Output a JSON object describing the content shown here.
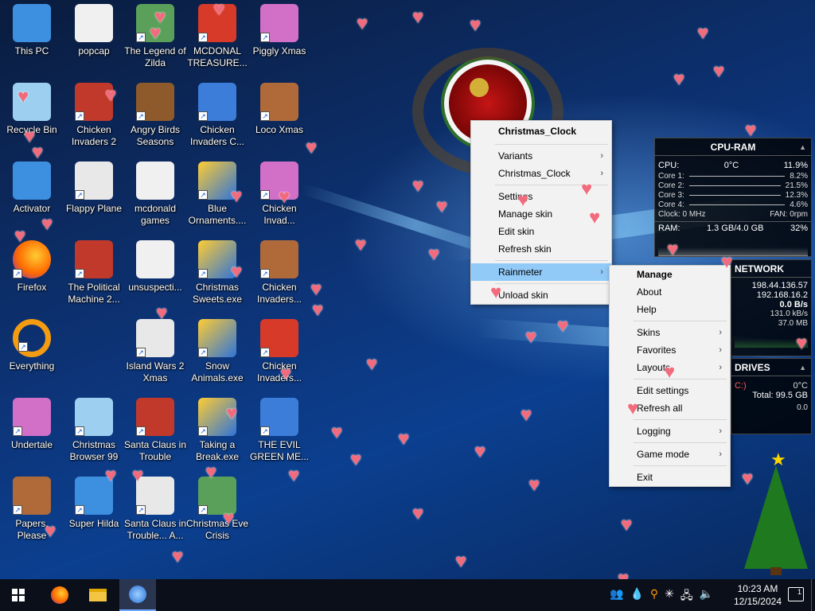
{
  "desktop": {
    "icons": [
      {
        "label": "This PC",
        "icon": "this-pc-icon"
      },
      {
        "label": "popcap",
        "icon": "folder-icon"
      },
      {
        "label": "The Legend of Zilda",
        "icon": "game-icon"
      },
      {
        "label": "MCDONAL TREASURE...",
        "icon": "game-icon"
      },
      {
        "label": "Piggly Xmas",
        "icon": "game-icon"
      },
      {
        "label": "Recycle Bin",
        "icon": "recycle-bin-icon"
      },
      {
        "label": "Chicken Invaders 2",
        "icon": "game-icon"
      },
      {
        "label": "Angry Birds Seasons",
        "icon": "game-icon"
      },
      {
        "label": "Chicken Invaders C...",
        "icon": "game-icon"
      },
      {
        "label": "Loco Xmas",
        "icon": "game-icon"
      },
      {
        "label": "Activator",
        "icon": "file-icon"
      },
      {
        "label": "Flappy Plane",
        "icon": "game-icon"
      },
      {
        "label": "mcdonald games",
        "icon": "folder-icon"
      },
      {
        "label": "Blue Ornaments....",
        "icon": "exe-icon"
      },
      {
        "label": "Chicken Invad...",
        "icon": "game-icon"
      },
      {
        "label": "Firefox",
        "icon": "firefox-icon"
      },
      {
        "label": "The Political Machine 2...",
        "icon": "game-icon"
      },
      {
        "label": "unsuspecti...",
        "icon": "folder-icon"
      },
      {
        "label": "Christmas Sweets.exe",
        "icon": "exe-icon"
      },
      {
        "label": "Chicken Invaders...",
        "icon": "game-icon"
      },
      {
        "label": "Everything",
        "icon": "search-app-icon"
      },
      {
        "label": "Island Wars 2 Xmas",
        "icon": "game-icon"
      },
      {
        "label": "Snow Animals.exe",
        "icon": "exe-icon"
      },
      {
        "label": "Chicken Invaders...",
        "icon": "game-icon"
      },
      {
        "label": "Undertale",
        "icon": "game-icon"
      },
      {
        "label": "Christmas Browser 99",
        "icon": "game-icon"
      },
      {
        "label": "Santa Claus in Trouble",
        "icon": "game-icon"
      },
      {
        "label": "Taking a Break.exe",
        "icon": "exe-icon"
      },
      {
        "label": "THE EVIL GREEN ME...",
        "icon": "game-icon"
      },
      {
        "label": "Papers, Please",
        "icon": "game-icon"
      },
      {
        "label": "Super Hilda",
        "icon": "game-icon"
      },
      {
        "label": "Santa Claus in Trouble... A...",
        "icon": "game-icon"
      },
      {
        "label": "Christmas Eve Crisis",
        "icon": "game-icon"
      }
    ]
  },
  "skin_menu": {
    "title": "Christmas_Clock",
    "items": [
      {
        "label": "Variants",
        "submenu": true
      },
      {
        "label": "Christmas_Clock",
        "submenu": true
      },
      {
        "label": "Settings",
        "submenu": false
      },
      {
        "label": "Manage skin",
        "submenu": false
      },
      {
        "label": "Edit skin",
        "submenu": false
      },
      {
        "label": "Refresh skin",
        "submenu": false
      },
      {
        "label": "Rainmeter",
        "submenu": true
      },
      {
        "label": "Unload skin",
        "submenu": false
      }
    ]
  },
  "rainmeter_menu": {
    "items": [
      {
        "label": "Manage",
        "bold": true
      },
      {
        "label": "About"
      },
      {
        "label": "Help"
      },
      {
        "label": "Skins",
        "submenu": true
      },
      {
        "label": "Favorites",
        "submenu": true
      },
      {
        "label": "Layouts",
        "submenu": true
      },
      {
        "label": "Edit settings"
      },
      {
        "label": "Refresh all"
      },
      {
        "label": "Logging",
        "submenu": true
      },
      {
        "label": "Game mode",
        "submenu": true
      },
      {
        "label": "Exit"
      }
    ]
  },
  "cpu_ram": {
    "title": "CPU-RAM",
    "cpu_label": "CPU:",
    "cpu_temp": "0°C",
    "cpu_pct": "11.9%",
    "cores": [
      {
        "label": "Core 1:",
        "value": "8.2%"
      },
      {
        "label": "Core 2:",
        "value": "21.5%"
      },
      {
        "label": "Core 3:",
        "value": "12.3%"
      },
      {
        "label": "Core 4:",
        "value": "4.6%"
      }
    ],
    "clock": "Clock: 0 MHz",
    "fan": "FAN: 0rpm",
    "ram_label": "RAM:",
    "ram_value": "1.3 GB/4.0 GB",
    "ram_pct": "32%"
  },
  "network": {
    "title": "NETWORK",
    "ip_public": "198.44.136.57",
    "ip_local": "192.168.16.2",
    "up": "0.0 B/s",
    "down": "131.0 kB/s",
    "sum": "37.0 MB"
  },
  "drives": {
    "title": "DRIVES",
    "drive_label": "C:)",
    "temp": "0°C",
    "total": "Total: 99.5 GB",
    "value": "0.0"
  },
  "taskbar": {
    "time": "10:23 AM",
    "date": "12/15/2024",
    "notification_badge": "1"
  },
  "colors": {
    "menu_highlight": "#91c9f7",
    "heart": "#f26b7d"
  }
}
